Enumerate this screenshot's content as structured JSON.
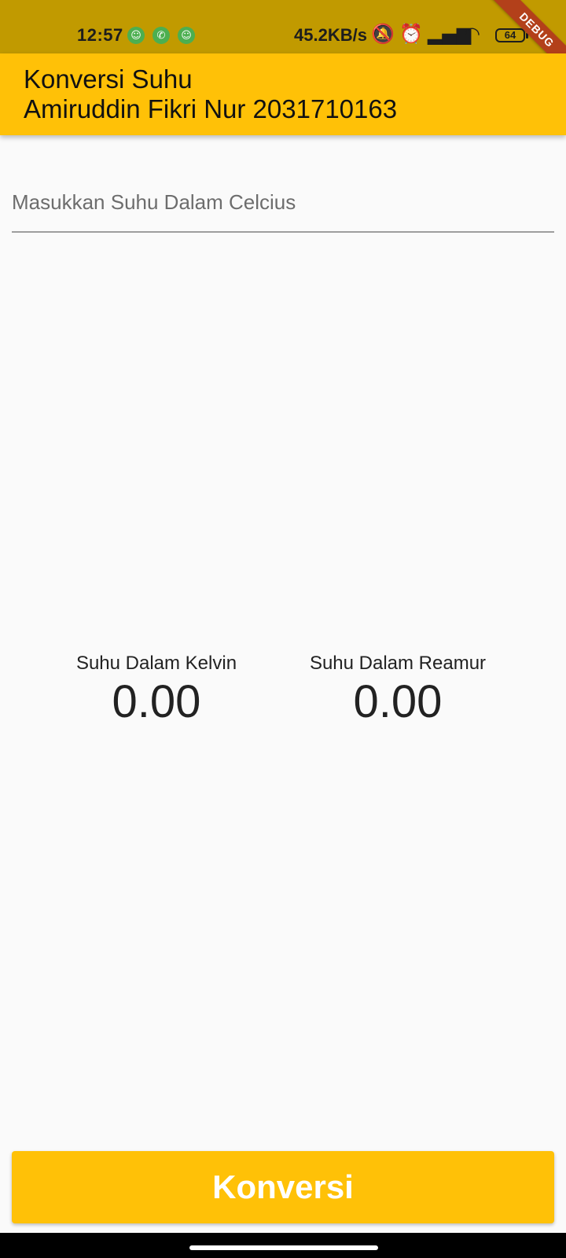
{
  "status_bar": {
    "time": "12:57",
    "notification_icons": [
      "app-icon",
      "whatsapp-icon",
      "app-icon"
    ],
    "network_speed": "45.2KB/s",
    "battery_level": "64",
    "background_color": "#c19a00"
  },
  "debug_banner": "DEBUG",
  "app_bar": {
    "title_line1": "Konversi Suhu",
    "title_line2": "Amiruddin Fikri Nur 2031710163",
    "background_color": "#ffc107"
  },
  "input": {
    "placeholder": "Masukkan Suhu Dalam Celcius",
    "value": ""
  },
  "results": {
    "kelvin_label": "Suhu Dalam Kelvin",
    "kelvin_value": "0.00",
    "reamur_label": "Suhu Dalam Reamur",
    "reamur_value": "0.00"
  },
  "convert_button": {
    "label": "Konversi",
    "color": "#ffc107"
  }
}
